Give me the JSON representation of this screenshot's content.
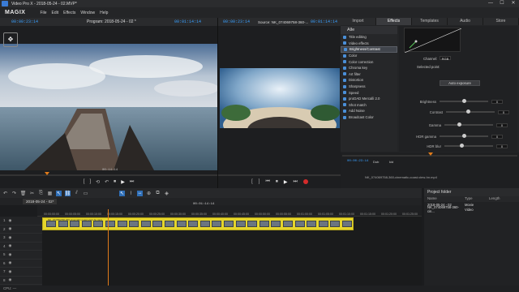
{
  "window": {
    "title": "Video Pro X - 2018-05-24 - 02.MVP*",
    "controls": [
      "—",
      "☐",
      "✕"
    ]
  },
  "menu": {
    "brand": "MAGIX",
    "items": [
      "File",
      "Edit",
      "Effects",
      "Window",
      "Help"
    ]
  },
  "program_monitor": {
    "timecode_left": "00:00:23:14",
    "label": "Program: 2018-05-24 - 02 *",
    "timecode_right": "00:01:14:14",
    "scrub_timecode": "00:14:14"
  },
  "source_monitor": {
    "timecode_left": "00:00:23:14",
    "label": "Source: NK_074069758-360-...",
    "timecode_right": "00:01:14:14"
  },
  "transport": {
    "program": [
      "[",
      "]",
      "⟲",
      "↶",
      "⏹",
      "▶",
      "⏭"
    ],
    "source": [
      "[",
      "]",
      "⏮",
      "⏹",
      "▶",
      "⏭"
    ]
  },
  "right_panel": {
    "tabs": [
      "Import",
      "Effects",
      "Templates",
      "Audio",
      "Store"
    ],
    "active_tab": "Effects",
    "list_header": "Alle",
    "effects": [
      "Title editing",
      "Video effects",
      "Brightness/Contrast",
      "Color",
      "Color correction",
      "Chroma key",
      "Art filter",
      "Distortion",
      "Sharpness",
      "Speed",
      "proDAD Mercalli 2.0",
      "Shot match",
      "Add Noise",
      "Broadcast Color"
    ],
    "selected_effect": "Brightness/Contrast",
    "settings": {
      "channel_label": "Channel:",
      "channel_value": "RGB",
      "selected_point_label": "Selected point:",
      "auto_button": "Auto exposure",
      "sliders": [
        {
          "label": "Brightness",
          "value": "0",
          "level": 0.5
        },
        {
          "label": "Contrast",
          "value": "0",
          "level": 0.45
        },
        {
          "label": "Gamma",
          "value": "0",
          "level": 0.3
        },
        {
          "label": "HDR gamma",
          "value": "0",
          "level": 0.5
        },
        {
          "label": "HDR blur",
          "value": "0",
          "level": 0.35
        }
      ]
    },
    "bottom_timecode": "00:00:23:14",
    "bottom_label_a": "Dub",
    "bottom_label_b": "kid",
    "file_info": "NK_074069758-360-cinematic-coast-view-hn.mp4"
  },
  "timeline": {
    "project_tab": "2018-05-24 - 02*",
    "center_timecode": "00:01:14:14",
    "ruler": [
      "00:00:00:00",
      "00:00:05:00",
      "00:00:10:00",
      "00:00:15:00",
      "00:00:20:00",
      "00:00:25:00",
      "00:00:30:00",
      "00:00:35:00",
      "00:00:40:00",
      "00:00:45:00",
      "00:00:50:00",
      "00:00:55:00",
      "00:01:00:00",
      "00:01:05:00",
      "00:01:10:00",
      "00:01:15:00",
      "00:01:20:00",
      "00:01:25:00"
    ],
    "tracks": [
      "1",
      "2",
      "3",
      "4",
      "5",
      "6",
      "7",
      "8"
    ],
    "clip_label": "NK_074069758-360-cinematic-coast-view-hn.mp4"
  },
  "project_folder": {
    "title": "Project folder",
    "columns": [
      "Name",
      "Type",
      "Length"
    ],
    "rows": [
      {
        "name": "2018-05-24 - 02",
        "type": "Movie",
        "length": ""
      },
      {
        "name": "NK_074069758-360-cin...",
        "type": "Video",
        "length": ""
      }
    ]
  },
  "status": {
    "text": "CPU: —"
  },
  "colors": {
    "accent_blue": "#3aa0ff",
    "clip_yellow": "#e5d52b",
    "playhead_orange": "#e07b1a",
    "record_red": "#d42b2b"
  }
}
